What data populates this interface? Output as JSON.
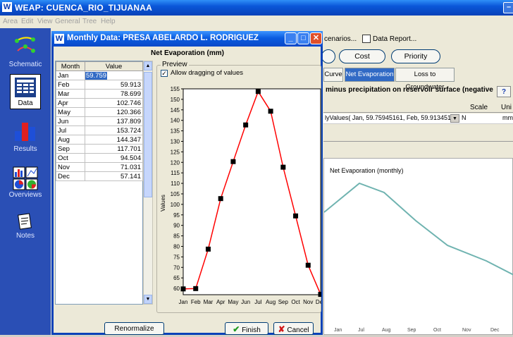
{
  "app": {
    "title": "WEAP: CUENCA_RIO_TIJUANAA",
    "logo_letter": "W"
  },
  "menu": [
    "Area",
    "Edit",
    "View",
    "General",
    "Tree",
    "Help"
  ],
  "sidebar": [
    {
      "label": "Schematic",
      "icon": "schematic-icon"
    },
    {
      "label": "Data",
      "icon": "data-icon"
    },
    {
      "label": "Results",
      "icon": "results-icon"
    },
    {
      "label": "Overviews",
      "icon": "overviews-icon"
    },
    {
      "label": "Notes",
      "icon": "notes-icon"
    }
  ],
  "background": {
    "scenarios_label": "cenarios...",
    "data_report_label": "Data Report...",
    "cost_label": "Cost",
    "priority_label": "Priority",
    "tabs": [
      "Curve",
      "Net Evaporation",
      "Loss to Groundwater"
    ],
    "active_tab": "Net Evaporation",
    "description": "minus precipitation on reservoir surface (negative",
    "help_label": "?",
    "col_scale": "Scale",
    "col_unit": "Uni",
    "expression": "lyValues( Jan, 59.75945161,  Feb, 59.91345161,  N",
    "unit_value": "mm",
    "chart_title": "Net Evaporation (monthly)",
    "bottom_ticks": [
      "Jan",
      "Jul",
      "Aug",
      "Sep",
      "Oct",
      "Nov",
      "Dec"
    ]
  },
  "dialog": {
    "title": "Monthly Data: PRESA ABELARDO L. RODRIGUEZ",
    "heading": "Net Evaporation (mm)",
    "col_month": "Month",
    "col_value": "Value",
    "rows": [
      {
        "month": "Jan",
        "value": "59.759"
      },
      {
        "month": "Feb",
        "value": "59.913"
      },
      {
        "month": "Mar",
        "value": "78.699"
      },
      {
        "month": "Apr",
        "value": "102.746"
      },
      {
        "month": "May",
        "value": "120.366"
      },
      {
        "month": "Jun",
        "value": "137.809"
      },
      {
        "month": "Jul",
        "value": "153.724"
      },
      {
        "month": "Aug",
        "value": "144.347"
      },
      {
        "month": "Sep",
        "value": "117.701"
      },
      {
        "month": "Oct",
        "value": "94.504"
      },
      {
        "month": "Nov",
        "value": "71.031"
      },
      {
        "month": "Dec",
        "value": "57.141"
      }
    ],
    "preview_label": "Preview",
    "allow_drag_label": "Allow dragging of values",
    "allow_drag_checked": true,
    "renormalize_label": "Renormalize",
    "finish_label": "Finish",
    "cancel_label": "Cancel"
  },
  "chart_data": {
    "type": "line",
    "categories": [
      "Jan",
      "Feb",
      "Mar",
      "Apr",
      "May",
      "Jun",
      "Jul",
      "Aug",
      "Sep",
      "Oct",
      "Nov",
      "Dec"
    ],
    "values": [
      59.759,
      59.913,
      78.699,
      102.746,
      120.366,
      137.809,
      153.724,
      144.347,
      117.701,
      94.504,
      71.031,
      57.141
    ],
    "ylabel": "Values",
    "ylim": [
      57,
      155
    ],
    "yticks": [
      60,
      65,
      70,
      75,
      80,
      85,
      90,
      95,
      100,
      105,
      110,
      115,
      120,
      125,
      130,
      135,
      140,
      145,
      150,
      155
    ],
    "line_color": "#ff0000",
    "marker_color": "#000000",
    "grid": false
  },
  "colors": {
    "xp_blue": "#0a48c8",
    "sidebar_blue": "#2a4fb5",
    "bg_line": "#6fb3b0"
  }
}
